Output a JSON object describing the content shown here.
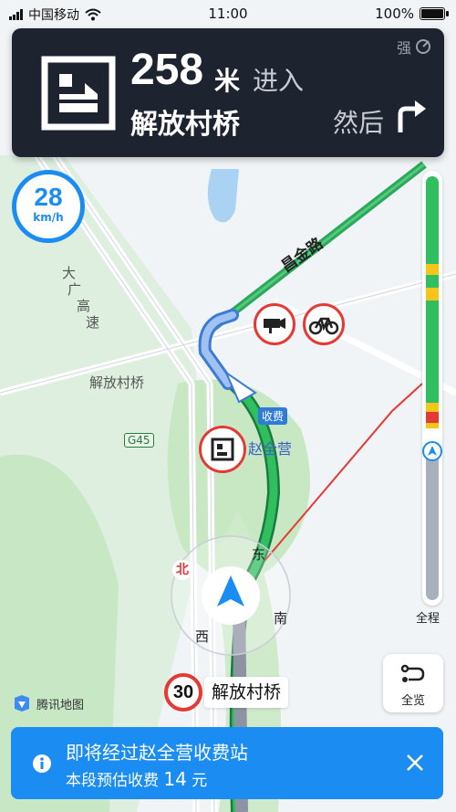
{
  "status": {
    "carrier": "中国移动",
    "time": "11:00",
    "battery": "100%"
  },
  "nav": {
    "distance": "258",
    "unit": "米",
    "action": "进入",
    "road": "解放村桥",
    "then": "然后",
    "signal": "强"
  },
  "speed": {
    "value": "28",
    "unit": "km/h"
  },
  "map": {
    "road_changjin": "昌金路",
    "road_dagao": [
      "大",
      "广",
      "高",
      "速"
    ],
    "place_jiefang": "解放村桥",
    "place_zhaoquanying": "赵全营",
    "toll_tag": "收费",
    "highway_shield": "G45",
    "compass": {
      "north": "北",
      "east": "东",
      "south": "南",
      "west": "西"
    }
  },
  "traffic": {
    "overview_label": "全程"
  },
  "overview_button": {
    "label": "全览"
  },
  "current_road": {
    "speed_limit": "30",
    "name": "解放村桥"
  },
  "logo": "腾讯地图",
  "banner": {
    "title": "即将经过赵全营收费站",
    "sub_prefix": "本段预估收费",
    "fee": "14",
    "fee_unit": "元"
  },
  "colors": {
    "primary": "#1a8cf2",
    "route": "#22a85a",
    "card": "#1e2330",
    "alert": "#e53935"
  }
}
